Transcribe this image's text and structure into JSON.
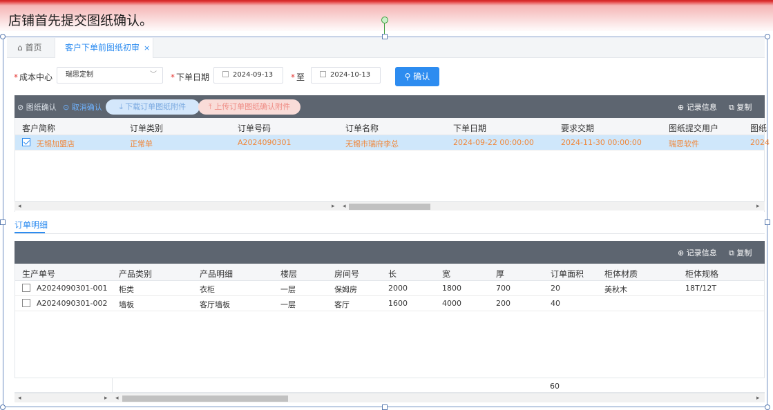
{
  "annotation": {
    "text": "店铺首先提交图纸确认。"
  },
  "tabs": {
    "home": "首页",
    "active": "客户下单前图纸初审",
    "close_glyph": "×",
    "home_icon": "home-icon"
  },
  "filters": {
    "cost_center_label": "成本中心",
    "cost_center_value": "瑞思定制",
    "date_label": "下单日期",
    "date_from": "2024-09-13",
    "to_label": "至",
    "date_to": "2024-10-13",
    "confirm_button": "确认",
    "required_mark": "*"
  },
  "toolbar1": {
    "confirm_drawing": "图纸确认",
    "cancel_confirm": "取消确认",
    "download_attach": "下载订单图纸附件",
    "upload_attach": "上传订单图纸确认附件",
    "record_info": "记录信息",
    "copy": "复制"
  },
  "orders": {
    "columns": [
      "客户简称",
      "订单类别",
      "订单号码",
      "订单名称",
      "下单日期",
      "要求交期",
      "图纸提交用户",
      "图纸"
    ],
    "rows": [
      {
        "customer": "无锡加盟店",
        "type": "正常单",
        "order_no": "A2024090301",
        "name": "无锡市瑞府李总",
        "order_date": "2024-09-22 00:00:00",
        "due_date": "2024-11-30 00:00:00",
        "user": "瑞思软件",
        "drawing": "2024"
      }
    ]
  },
  "detail_tab": "订单明细",
  "toolbar2": {
    "record_info": "记录信息",
    "copy": "复制"
  },
  "details": {
    "columns": [
      "生产单号",
      "产品类别",
      "产品明细",
      "楼层",
      "房间号",
      "长",
      "宽",
      "厚",
      "订单面积",
      "柜体材质",
      "柜体规格"
    ],
    "rows": [
      {
        "prod_no": "A2024090301-001",
        "category": "柜类",
        "detail": "衣柜",
        "floor": "一层",
        "room": "保姆房",
        "length": "2000",
        "width": "1800",
        "thick": "700",
        "area": "20",
        "material": "美秋木",
        "spec": "18T/12T"
      },
      {
        "prod_no": "A2024090301-002",
        "category": "墙板",
        "detail": "客厅墙板",
        "floor": "一层",
        "room": "客厅",
        "length": "1600",
        "width": "4000",
        "thick": "200",
        "area": "40",
        "material": "",
        "spec": ""
      }
    ],
    "total_area": "60"
  },
  "colors": {
    "accent": "#2d8cf0",
    "toolbar": "#5d6570",
    "selected_row": "#cfe7fb",
    "selected_text": "#f0873a"
  }
}
